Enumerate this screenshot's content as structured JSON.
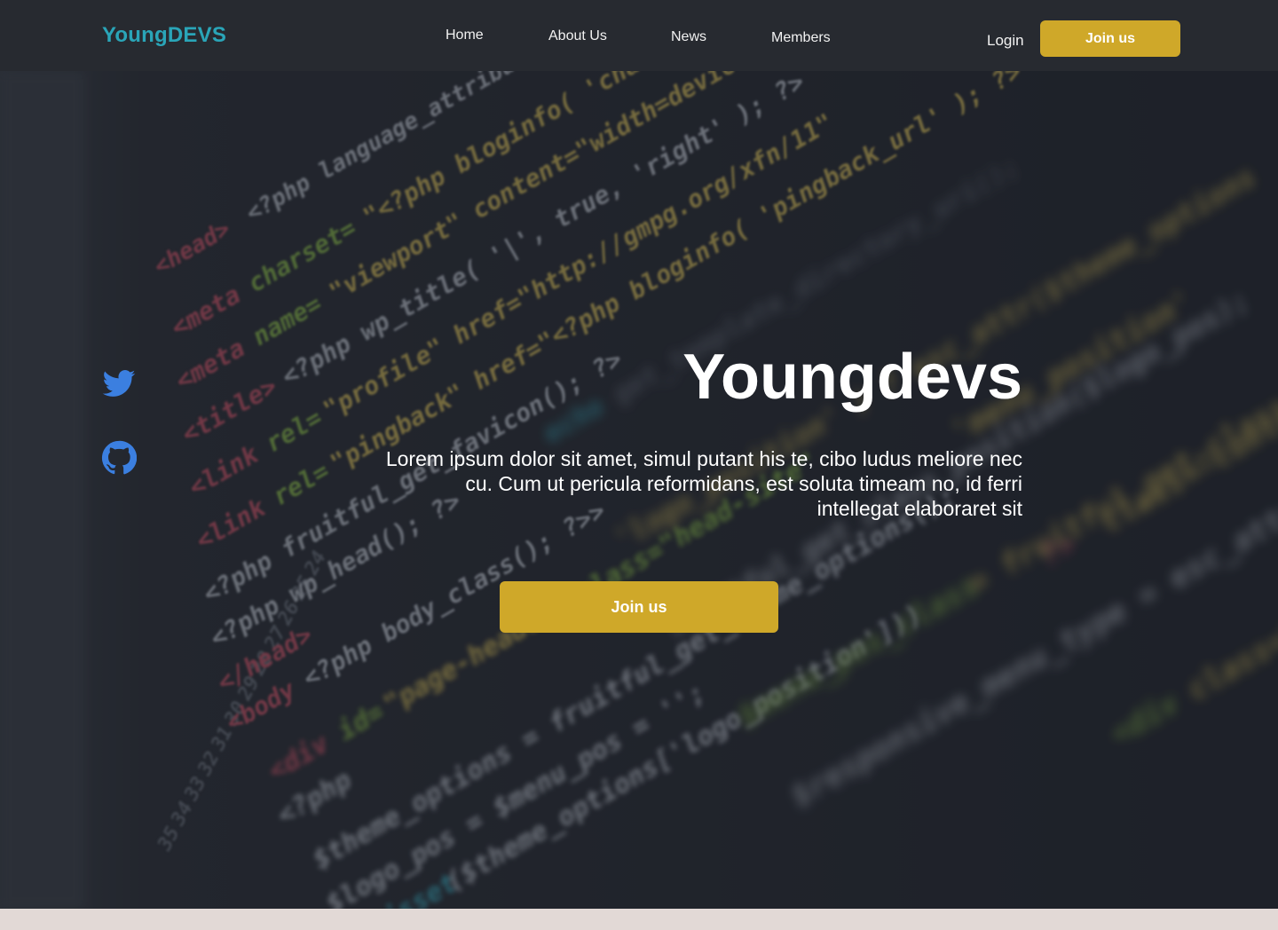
{
  "nav": {
    "brand": "YoungDEVS",
    "links": [
      "Home",
      "About Us",
      "News",
      "Members"
    ],
    "login": "Login",
    "join": "Join us"
  },
  "hero": {
    "title": "Youngdevs",
    "text": "Lorem ipsum dolor sit amet, simul putant his te, cibo ludus meliore nec cu. Cum ut pericula reformidans, est soluta timeam no, id ferri intellegat elaboraret sit",
    "join": "Join us"
  },
  "social": {
    "items": [
      {
        "icon": "twitter-icon"
      },
      {
        "icon": "github-icon"
      }
    ]
  },
  "colors": {
    "brand": "#2aa5b8",
    "accent": "#cfa829",
    "navbar": "#272a30",
    "icon": "#3b7fe0"
  }
}
